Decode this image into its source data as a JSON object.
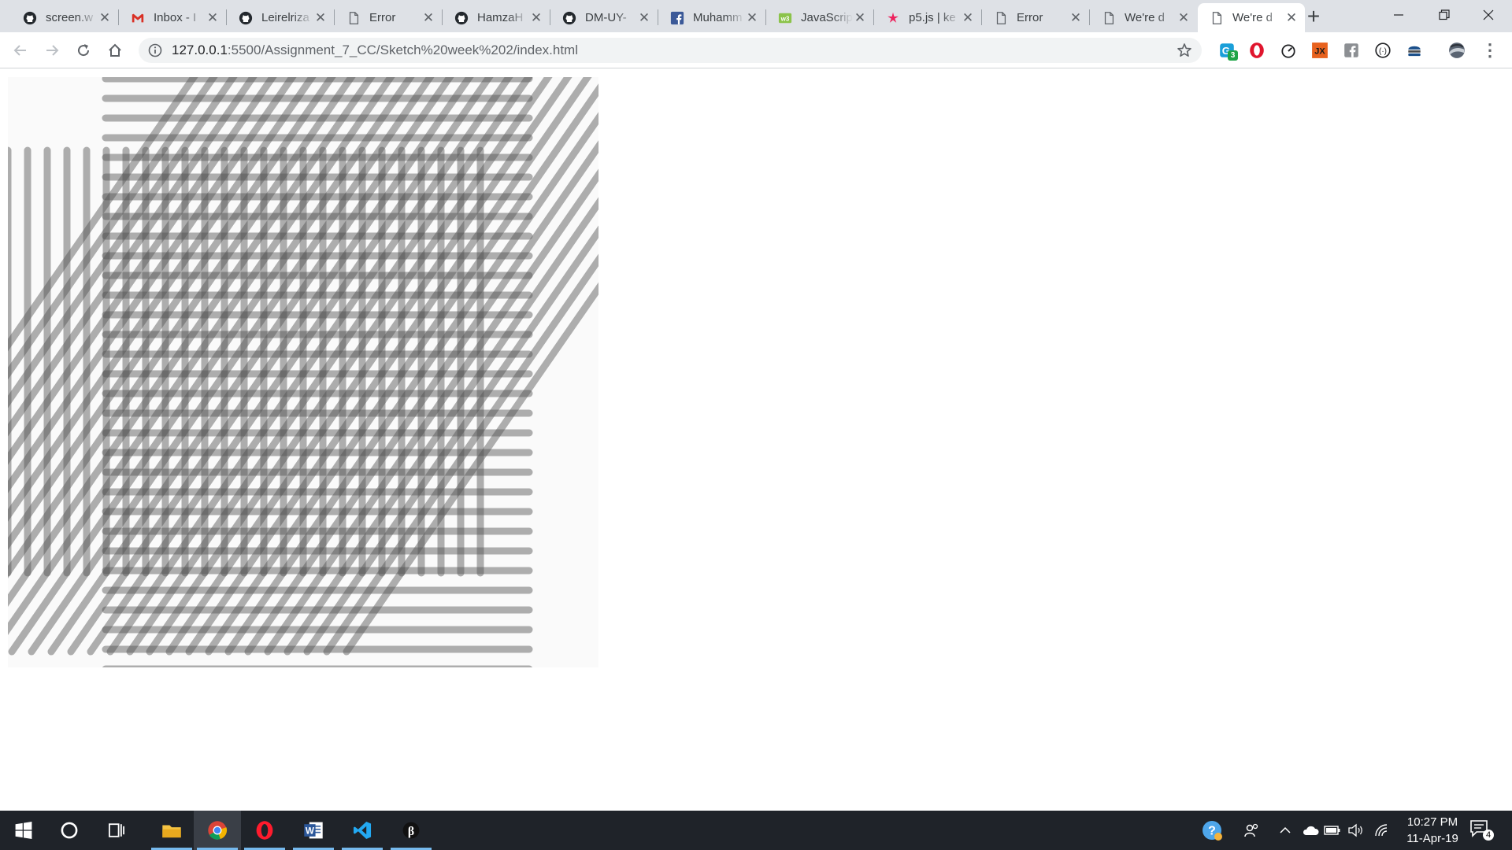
{
  "browser": {
    "tabs": [
      {
        "title": "screen.w",
        "icon": "github-icon",
        "active": false
      },
      {
        "title": "Inbox - I",
        "icon": "gmail-icon",
        "active": false
      },
      {
        "title": "Leirelriza",
        "icon": "github-icon",
        "active": false
      },
      {
        "title": "Error",
        "icon": "document-icon",
        "active": false
      },
      {
        "title": "HamzaH",
        "icon": "github-icon",
        "active": false
      },
      {
        "title": "DM-UY-",
        "icon": "github-icon",
        "active": false
      },
      {
        "title": "Muhamm",
        "icon": "facebook-icon",
        "active": false
      },
      {
        "title": "JavaScrip",
        "icon": "w3schools-icon",
        "active": false
      },
      {
        "title": "p5.js | ke",
        "icon": "p5js-asterisk-icon",
        "active": false
      },
      {
        "title": "Error",
        "icon": "document-icon",
        "active": false
      },
      {
        "title": "We're d",
        "icon": "document-icon",
        "active": false
      },
      {
        "title": "We're d",
        "icon": "document-icon",
        "active": true
      }
    ],
    "tab_close_glyph": "✕",
    "new_tab_glyph": "+",
    "window_controls": {
      "minimize": "—",
      "restore": "❐",
      "close": "✕"
    },
    "url": {
      "host": "127.0.0.1",
      "path": ":5500/Assignment_7_CC/Sketch%20week%202/index.html"
    },
    "extensions": [
      {
        "name": "grammar-extension-icon",
        "badge": "3"
      },
      {
        "name": "opera-extension-icon"
      },
      {
        "name": "speed-dial-icon"
      },
      {
        "name": "jx-extension-icon"
      },
      {
        "name": "facebook-grey-icon"
      },
      {
        "name": "code-brackets-icon"
      },
      {
        "name": "hamburger-extension-icon"
      },
      {
        "name": "profile-avatar-icon"
      }
    ],
    "menu_glyph": "⋮"
  },
  "sketch": {
    "background": "#fafafa",
    "stroke_color": "rgba(80,80,80,0.45)",
    "description_colors": [
      "#a6a6a6",
      "#5b5b5b"
    ]
  },
  "taskbar": {
    "apps": [
      {
        "name": "start-windows-icon"
      },
      {
        "name": "cortana-search-icon"
      },
      {
        "name": "task-view-icon"
      },
      {
        "name": "file-explorer-icon",
        "running": true
      },
      {
        "name": "chrome-icon",
        "running": true,
        "active": true
      },
      {
        "name": "opera-icon",
        "running": true
      },
      {
        "name": "word-icon",
        "running": true
      },
      {
        "name": "vscode-icon",
        "running": true
      },
      {
        "name": "p5-editor-icon",
        "running": true
      }
    ],
    "clock": {
      "time": "10:27 PM",
      "date": "11-Apr-19"
    },
    "notification_count": "4"
  }
}
